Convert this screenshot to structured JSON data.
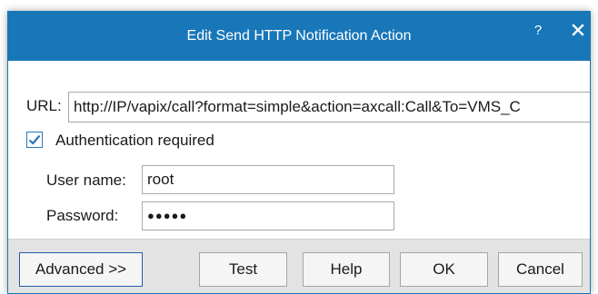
{
  "window": {
    "title": "Edit Send HTTP Notification Action",
    "help_label": "?",
    "close_icon": "close-icon"
  },
  "form": {
    "url_label": "URL:",
    "url_value": "http://IP/vapix/call?format=simple&action=axcall:Call&To=VMS_C",
    "auth_label": "Authentication required",
    "auth_checked": true,
    "username_label": "User name:",
    "username_value": "root",
    "password_label": "Password:",
    "password_value": "●●●●●"
  },
  "buttons": {
    "advanced": "Advanced >>",
    "test": "Test",
    "help": "Help",
    "ok": "OK",
    "cancel": "Cancel"
  },
  "colors": {
    "titlebar": "#1877b9",
    "footer": "#e3e3e3",
    "checkbox_accent": "#2b78b8"
  }
}
